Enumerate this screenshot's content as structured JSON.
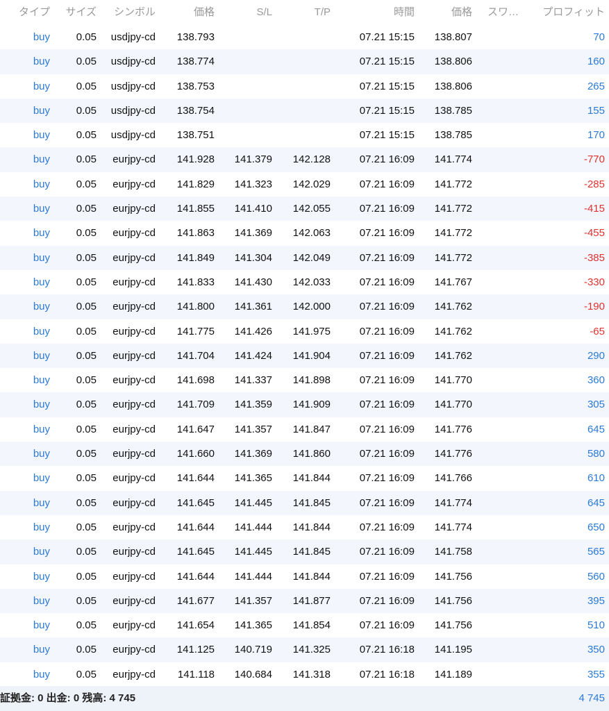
{
  "header": {
    "type": "タイプ",
    "size": "サイズ",
    "symbol": "シンボル",
    "price": "価格",
    "sl": "S/L",
    "tp": "T/P",
    "time": "時間",
    "price2": "価格",
    "swap": "スワ…",
    "profit": "プロフィット"
  },
  "rows": [
    {
      "type": "buy",
      "size": "0.05",
      "symbol": "usdjpy-cd",
      "price": "138.793",
      "sl": "",
      "tp": "",
      "time": "07.21 15:15",
      "price2": "138.807",
      "swap": "",
      "profit": "70",
      "sign": "pos"
    },
    {
      "type": "buy",
      "size": "0.05",
      "symbol": "usdjpy-cd",
      "price": "138.774",
      "sl": "",
      "tp": "",
      "time": "07.21 15:15",
      "price2": "138.806",
      "swap": "",
      "profit": "160",
      "sign": "pos"
    },
    {
      "type": "buy",
      "size": "0.05",
      "symbol": "usdjpy-cd",
      "price": "138.753",
      "sl": "",
      "tp": "",
      "time": "07.21 15:15",
      "price2": "138.806",
      "swap": "",
      "profit": "265",
      "sign": "pos"
    },
    {
      "type": "buy",
      "size": "0.05",
      "symbol": "usdjpy-cd",
      "price": "138.754",
      "sl": "",
      "tp": "",
      "time": "07.21 15:15",
      "price2": "138.785",
      "swap": "",
      "profit": "155",
      "sign": "pos"
    },
    {
      "type": "buy",
      "size": "0.05",
      "symbol": "usdjpy-cd",
      "price": "138.751",
      "sl": "",
      "tp": "",
      "time": "07.21 15:15",
      "price2": "138.785",
      "swap": "",
      "profit": "170",
      "sign": "pos"
    },
    {
      "type": "buy",
      "size": "0.05",
      "symbol": "eurjpy-cd",
      "price": "141.928",
      "sl": "141.379",
      "tp": "142.128",
      "time": "07.21 16:09",
      "price2": "141.774",
      "swap": "",
      "profit": "-770",
      "sign": "neg"
    },
    {
      "type": "buy",
      "size": "0.05",
      "symbol": "eurjpy-cd",
      "price": "141.829",
      "sl": "141.323",
      "tp": "142.029",
      "time": "07.21 16:09",
      "price2": "141.772",
      "swap": "",
      "profit": "-285",
      "sign": "neg"
    },
    {
      "type": "buy",
      "size": "0.05",
      "symbol": "eurjpy-cd",
      "price": "141.855",
      "sl": "141.410",
      "tp": "142.055",
      "time": "07.21 16:09",
      "price2": "141.772",
      "swap": "",
      "profit": "-415",
      "sign": "neg"
    },
    {
      "type": "buy",
      "size": "0.05",
      "symbol": "eurjpy-cd",
      "price": "141.863",
      "sl": "141.369",
      "tp": "142.063",
      "time": "07.21 16:09",
      "price2": "141.772",
      "swap": "",
      "profit": "-455",
      "sign": "neg"
    },
    {
      "type": "buy",
      "size": "0.05",
      "symbol": "eurjpy-cd",
      "price": "141.849",
      "sl": "141.304",
      "tp": "142.049",
      "time": "07.21 16:09",
      "price2": "141.772",
      "swap": "",
      "profit": "-385",
      "sign": "neg"
    },
    {
      "type": "buy",
      "size": "0.05",
      "symbol": "eurjpy-cd",
      "price": "141.833",
      "sl": "141.430",
      "tp": "142.033",
      "time": "07.21 16:09",
      "price2": "141.767",
      "swap": "",
      "profit": "-330",
      "sign": "neg"
    },
    {
      "type": "buy",
      "size": "0.05",
      "symbol": "eurjpy-cd",
      "price": "141.800",
      "sl": "141.361",
      "tp": "142.000",
      "time": "07.21 16:09",
      "price2": "141.762",
      "swap": "",
      "profit": "-190",
      "sign": "neg"
    },
    {
      "type": "buy",
      "size": "0.05",
      "symbol": "eurjpy-cd",
      "price": "141.775",
      "sl": "141.426",
      "tp": "141.975",
      "time": "07.21 16:09",
      "price2": "141.762",
      "swap": "",
      "profit": "-65",
      "sign": "neg"
    },
    {
      "type": "buy",
      "size": "0.05",
      "symbol": "eurjpy-cd",
      "price": "141.704",
      "sl": "141.424",
      "tp": "141.904",
      "time": "07.21 16:09",
      "price2": "141.762",
      "swap": "",
      "profit": "290",
      "sign": "pos"
    },
    {
      "type": "buy",
      "size": "0.05",
      "symbol": "eurjpy-cd",
      "price": "141.698",
      "sl": "141.337",
      "tp": "141.898",
      "time": "07.21 16:09",
      "price2": "141.770",
      "swap": "",
      "profit": "360",
      "sign": "pos"
    },
    {
      "type": "buy",
      "size": "0.05",
      "symbol": "eurjpy-cd",
      "price": "141.709",
      "sl": "141.359",
      "tp": "141.909",
      "time": "07.21 16:09",
      "price2": "141.770",
      "swap": "",
      "profit": "305",
      "sign": "pos"
    },
    {
      "type": "buy",
      "size": "0.05",
      "symbol": "eurjpy-cd",
      "price": "141.647",
      "sl": "141.357",
      "tp": "141.847",
      "time": "07.21 16:09",
      "price2": "141.776",
      "swap": "",
      "profit": "645",
      "sign": "pos"
    },
    {
      "type": "buy",
      "size": "0.05",
      "symbol": "eurjpy-cd",
      "price": "141.660",
      "sl": "141.369",
      "tp": "141.860",
      "time": "07.21 16:09",
      "price2": "141.776",
      "swap": "",
      "profit": "580",
      "sign": "pos"
    },
    {
      "type": "buy",
      "size": "0.05",
      "symbol": "eurjpy-cd",
      "price": "141.644",
      "sl": "141.365",
      "tp": "141.844",
      "time": "07.21 16:09",
      "price2": "141.766",
      "swap": "",
      "profit": "610",
      "sign": "pos"
    },
    {
      "type": "buy",
      "size": "0.05",
      "symbol": "eurjpy-cd",
      "price": "141.645",
      "sl": "141.445",
      "tp": "141.845",
      "time": "07.21 16:09",
      "price2": "141.774",
      "swap": "",
      "profit": "645",
      "sign": "pos"
    },
    {
      "type": "buy",
      "size": "0.05",
      "symbol": "eurjpy-cd",
      "price": "141.644",
      "sl": "141.444",
      "tp": "141.844",
      "time": "07.21 16:09",
      "price2": "141.774",
      "swap": "",
      "profit": "650",
      "sign": "pos"
    },
    {
      "type": "buy",
      "size": "0.05",
      "symbol": "eurjpy-cd",
      "price": "141.645",
      "sl": "141.445",
      "tp": "141.845",
      "time": "07.21 16:09",
      "price2": "141.758",
      "swap": "",
      "profit": "565",
      "sign": "pos"
    },
    {
      "type": "buy",
      "size": "0.05",
      "symbol": "eurjpy-cd",
      "price": "141.644",
      "sl": "141.444",
      "tp": "141.844",
      "time": "07.21 16:09",
      "price2": "141.756",
      "swap": "",
      "profit": "560",
      "sign": "pos"
    },
    {
      "type": "buy",
      "size": "0.05",
      "symbol": "eurjpy-cd",
      "price": "141.677",
      "sl": "141.357",
      "tp": "141.877",
      "time": "07.21 16:09",
      "price2": "141.756",
      "swap": "",
      "profit": "395",
      "sign": "pos"
    },
    {
      "type": "buy",
      "size": "0.05",
      "symbol": "eurjpy-cd",
      "price": "141.654",
      "sl": "141.365",
      "tp": "141.854",
      "time": "07.21 16:09",
      "price2": "141.756",
      "swap": "",
      "profit": "510",
      "sign": "pos"
    },
    {
      "type": "buy",
      "size": "0.05",
      "symbol": "eurjpy-cd",
      "price": "141.125",
      "sl": "140.719",
      "tp": "141.325",
      "time": "07.21 16:18",
      "price2": "141.195",
      "swap": "",
      "profit": "350",
      "sign": "pos"
    },
    {
      "type": "buy",
      "size": "0.05",
      "symbol": "eurjpy-cd",
      "price": "141.118",
      "sl": "140.684",
      "tp": "141.318",
      "time": "07.21 16:18",
      "price2": "141.189",
      "swap": "",
      "profit": "355",
      "sign": "pos"
    }
  ],
  "footer": {
    "summary": "証拠金: 0 出金: 0 残高: 4 745",
    "total": "4 745"
  },
  "colors": {
    "buy": "#2b7ad8",
    "profit_positive": "#2b7ad8",
    "profit_negative": "#e0322f",
    "row_alt": "#f3f6fc",
    "footer_bg": "#eef2f9"
  }
}
